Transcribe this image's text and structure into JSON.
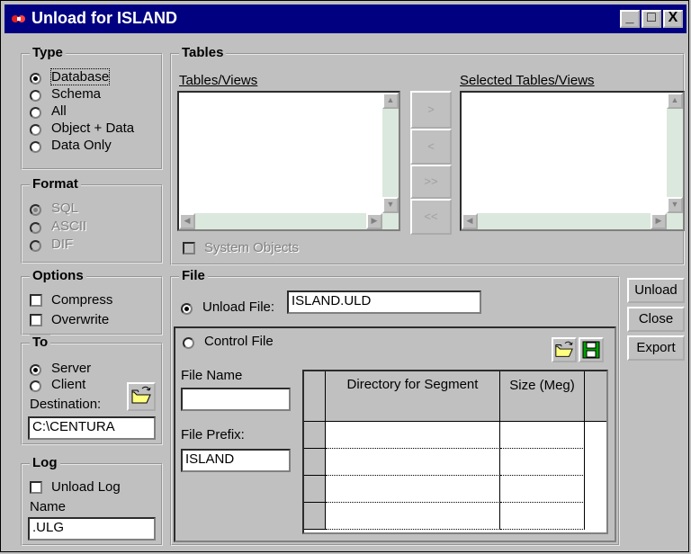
{
  "window": {
    "title": "Unload for ISLAND",
    "minimize": "_",
    "maximize": "□",
    "close": "X"
  },
  "type_group": {
    "title": "Type",
    "options": [
      "Database",
      "Schema",
      "All",
      "Object + Data",
      "Data Only"
    ],
    "selected": "Database"
  },
  "format_group": {
    "title": "Format",
    "options": [
      "SQL",
      "ASCII",
      "DIF"
    ],
    "selected": "SQL"
  },
  "tables_group": {
    "title": "Tables",
    "left_label": "Tables/Views",
    "right_label": "Selected Tables/Views",
    "buttons": [
      ">",
      "<",
      ">>",
      "<<"
    ],
    "system_objects": "System Objects"
  },
  "options_group": {
    "title": "Options",
    "compress": "Compress",
    "overwrite": "Overwrite"
  },
  "to_group": {
    "title": "To",
    "server": "Server",
    "client": "Client",
    "destination_label": "Destination:",
    "destination_value": "C:\\CENTURA"
  },
  "log_group": {
    "title": "Log",
    "unload_log": "Unload Log",
    "name_label": "Name",
    "name_value": ".ULG"
  },
  "file_group": {
    "title": "File",
    "unload_file_label": "Unload File:",
    "unload_file_value": "ISLAND.ULD",
    "control_file_label": "Control File",
    "file_name_label": "File Name",
    "file_name_value": "",
    "file_prefix_label": "File Prefix:",
    "file_prefix_value": "ISLAND",
    "grid_headers": [
      "Directory for Segment",
      "Size (Meg)"
    ]
  },
  "side_buttons": {
    "unload": "Unload",
    "close": "Close",
    "export": "Export"
  }
}
